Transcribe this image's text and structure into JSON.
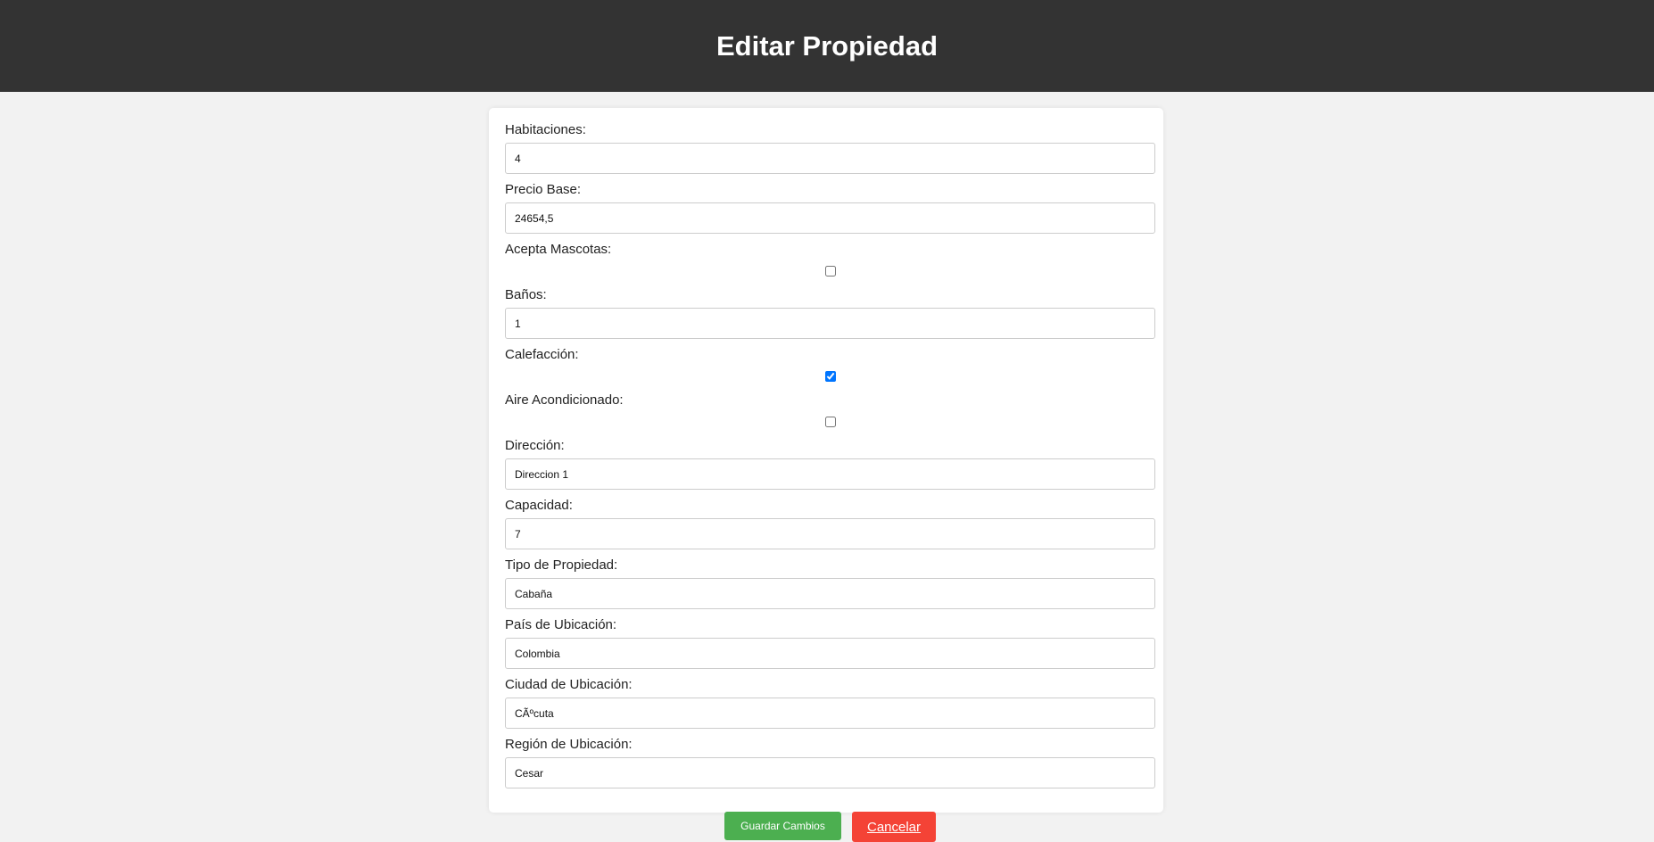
{
  "header": {
    "title": "Editar Propiedad"
  },
  "form": {
    "habitaciones": {
      "label": "Habitaciones:",
      "value": "4"
    },
    "precio_base": {
      "label": "Precio Base:",
      "value": "24654,5"
    },
    "acepta_mascotas": {
      "label": "Acepta Mascotas:",
      "checked": false
    },
    "banos": {
      "label": "Baños:",
      "value": "1"
    },
    "calefaccion": {
      "label": "Calefacción:",
      "checked": true
    },
    "aire_acondicionado": {
      "label": "Aire Acondicionado:",
      "checked": false
    },
    "direccion": {
      "label": "Dirección:",
      "value": "Direccion 1"
    },
    "capacidad": {
      "label": "Capacidad:",
      "value": "7"
    },
    "tipo_propiedad": {
      "label": "Tipo de Propiedad:",
      "value": "Cabaña"
    },
    "pais": {
      "label": "País de Ubicación:",
      "value": "Colombia"
    },
    "ciudad": {
      "label": "Ciudad de Ubicación:",
      "value": "CÃºcuta"
    },
    "region": {
      "label": "Región de Ubicación:",
      "value": "Cesar"
    }
  },
  "actions": {
    "save_label": "Guardar Cambios",
    "cancel_label": "Cancelar"
  },
  "colors": {
    "header_bg": "#333333",
    "save": "#4caf50",
    "cancel": "#f44336"
  }
}
